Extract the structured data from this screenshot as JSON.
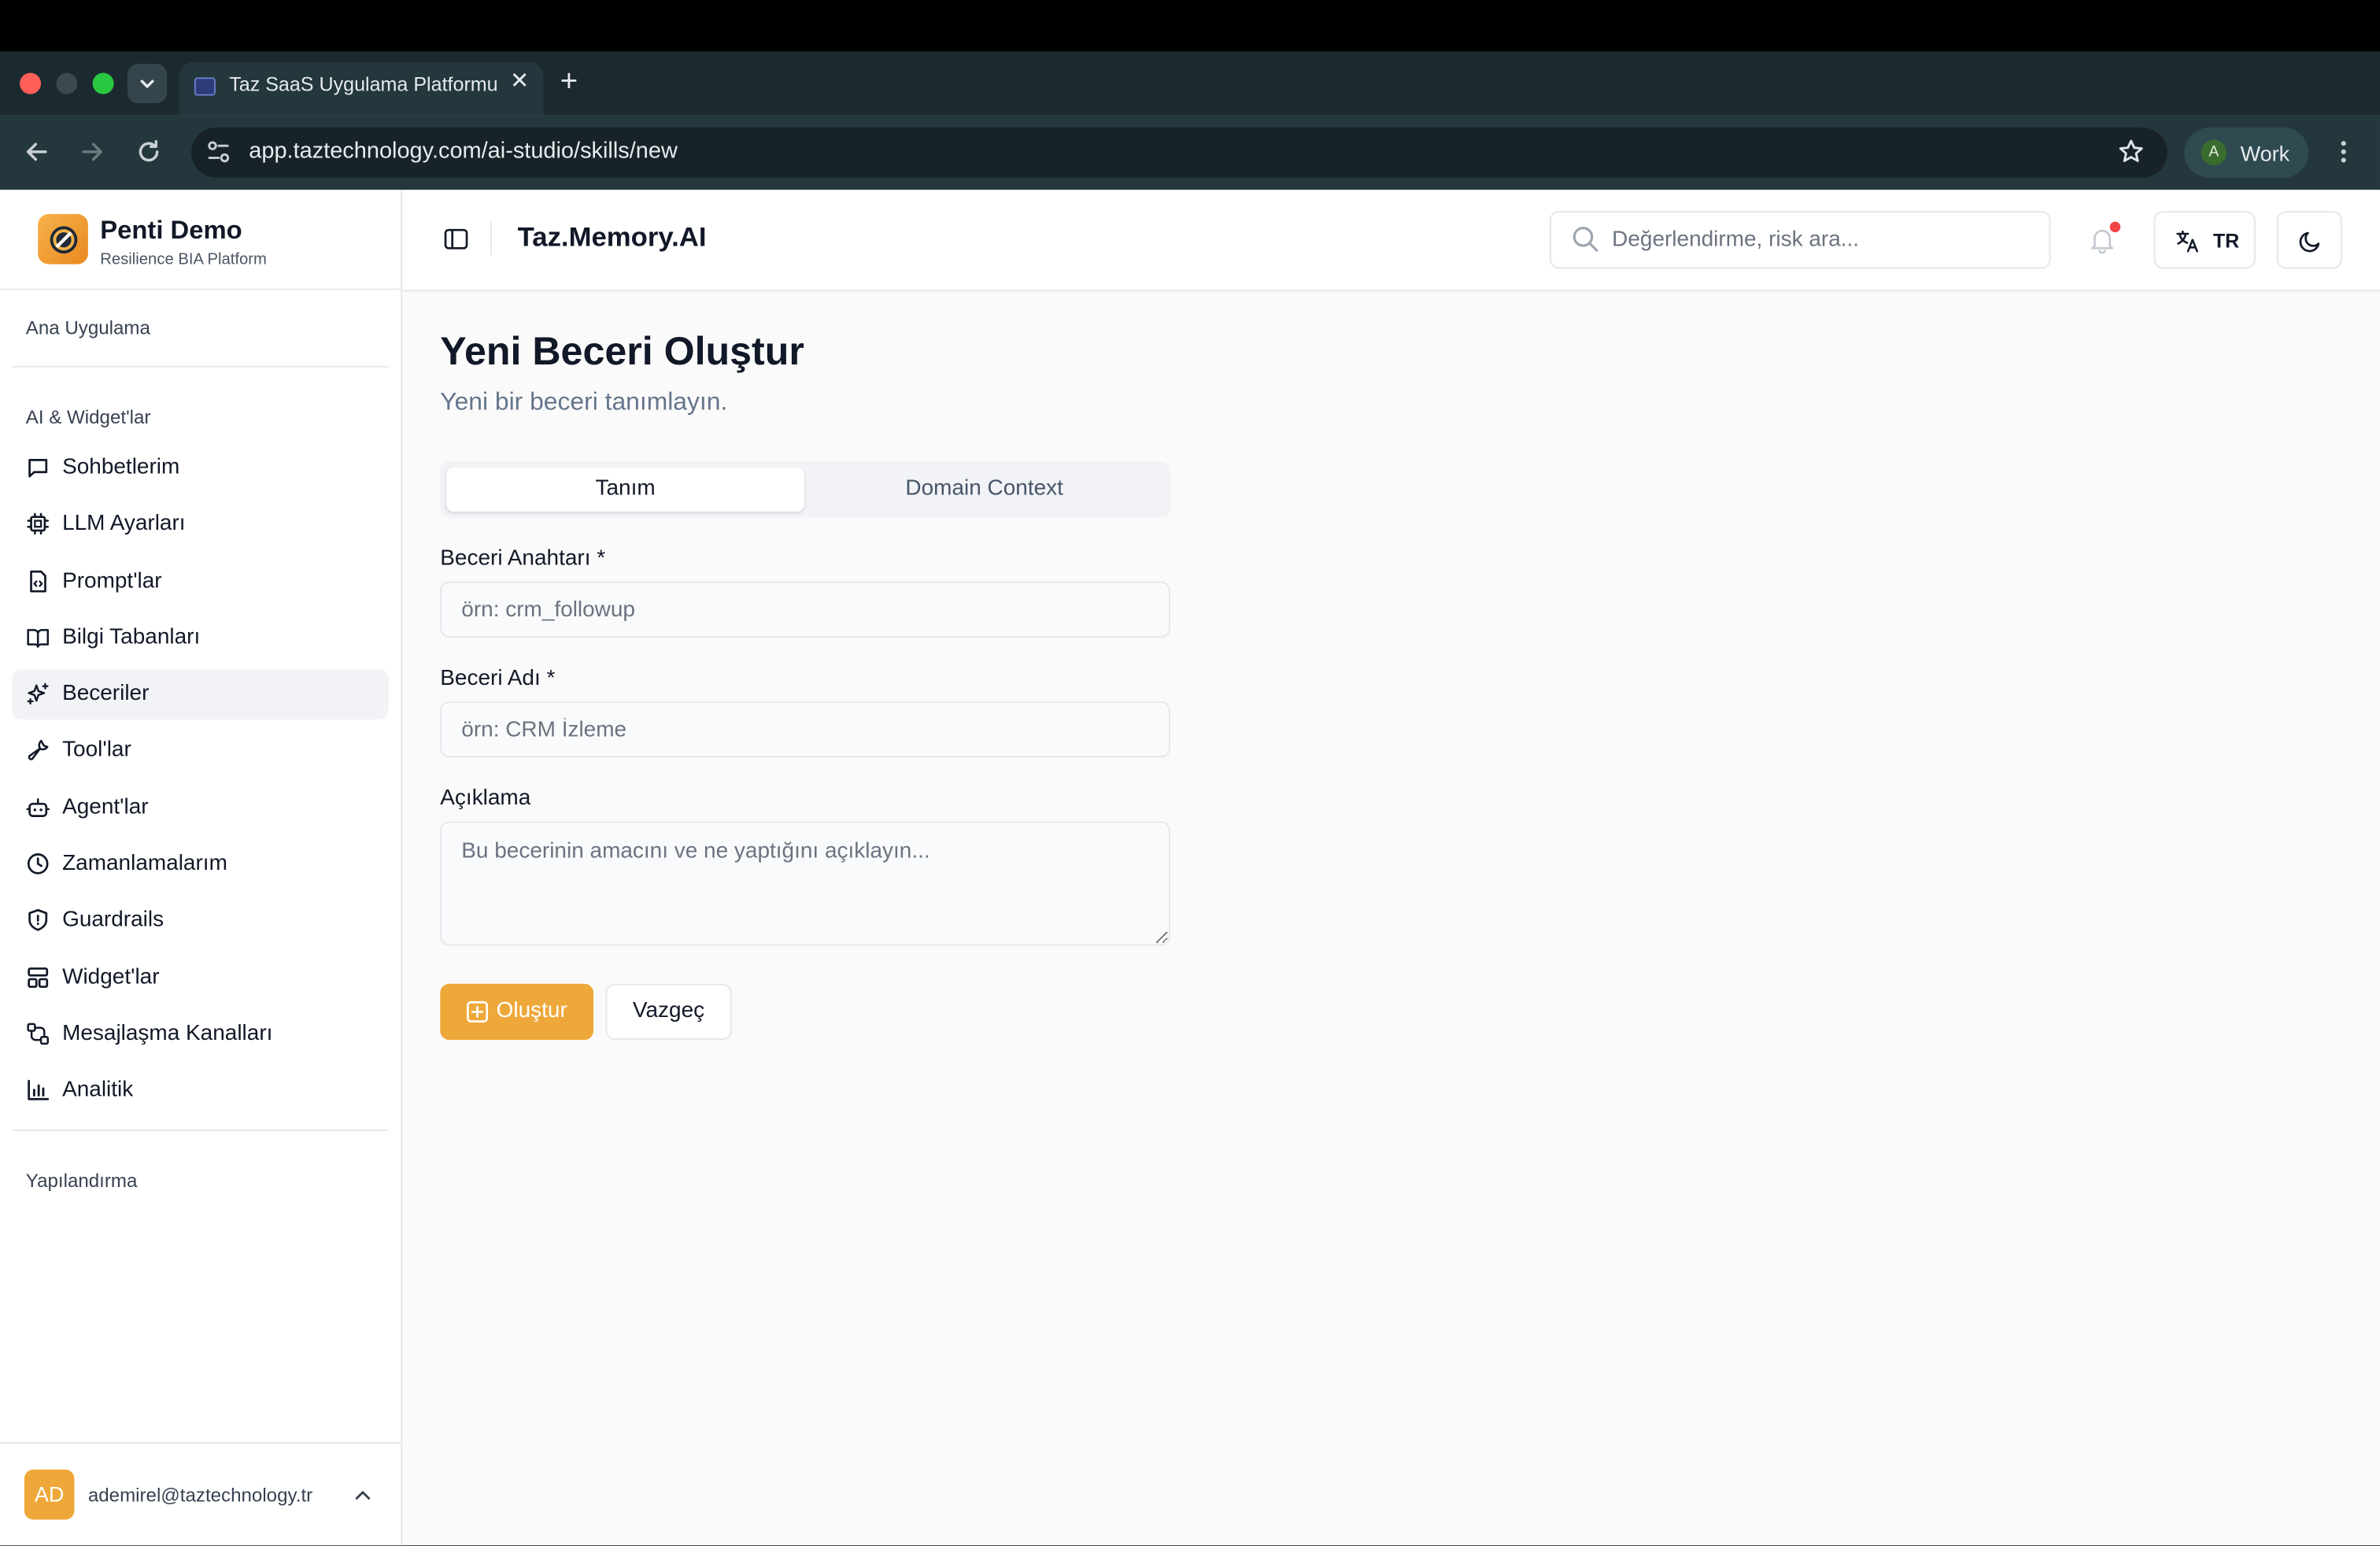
{
  "browser": {
    "tab_title": "Taz SaaS Uygulama Platformu",
    "url": "app.taztechnology.com/ai-studio/skills/new",
    "profile_initial": "A",
    "profile_label": "Work"
  },
  "sidebar": {
    "brand_title": "Penti Demo",
    "brand_subtitle": "Resilience BIA Platform",
    "section_main": "Ana Uygulama",
    "section_ai": "AI & Widget'lar",
    "section_config": "Yapılandırma",
    "items": [
      {
        "label": "Sohbetlerim",
        "icon": "message-square-icon"
      },
      {
        "label": "LLM Ayarları",
        "icon": "cpu-icon"
      },
      {
        "label": "Prompt'lar",
        "icon": "file-code-icon"
      },
      {
        "label": "Bilgi Tabanları",
        "icon": "book-open-icon"
      },
      {
        "label": "Beceriler",
        "icon": "sparkles-icon",
        "active": true
      },
      {
        "label": "Tool'lar",
        "icon": "wrench-icon"
      },
      {
        "label": "Agent'lar",
        "icon": "bot-icon"
      },
      {
        "label": "Zamanlamalarım",
        "icon": "clock-icon"
      },
      {
        "label": "Guardrails",
        "icon": "shield-icon"
      },
      {
        "label": "Widget'lar",
        "icon": "layout-icon"
      },
      {
        "label": "Mesajlaşma Kanalları",
        "icon": "workflow-icon"
      },
      {
        "label": "Analitik",
        "icon": "bar-chart-icon"
      }
    ],
    "user_initials": "AD",
    "user_email": "ademirel@taztechnology.tr"
  },
  "header": {
    "app_title": "Taz.Memory.AI",
    "search_placeholder": "Değerlendirme, risk ara...",
    "language": "TR"
  },
  "main": {
    "title": "Yeni Beceri Oluştur",
    "subtitle": "Yeni bir beceri tanımlayın.",
    "tabs": [
      {
        "label": "Tanım",
        "active": true
      },
      {
        "label": "Domain Context",
        "active": false
      }
    ],
    "form": {
      "skill_key_label": "Beceri Anahtarı *",
      "skill_key_placeholder": "örn: crm_followup",
      "skill_key_value": "",
      "skill_name_label": "Beceri Adı *",
      "skill_name_placeholder": "örn: CRM İzleme",
      "skill_name_value": "",
      "description_label": "Açıklama",
      "description_placeholder": "Bu becerinin amacını ve ne yaptığını açıklayın...",
      "description_value": ""
    },
    "create_label": "Oluştur",
    "cancel_label": "Vazgeç"
  },
  "colors": {
    "accent": "#eea83a",
    "notification_dot": "#ef4444",
    "active_nav_bg": "#f1f3f6"
  }
}
